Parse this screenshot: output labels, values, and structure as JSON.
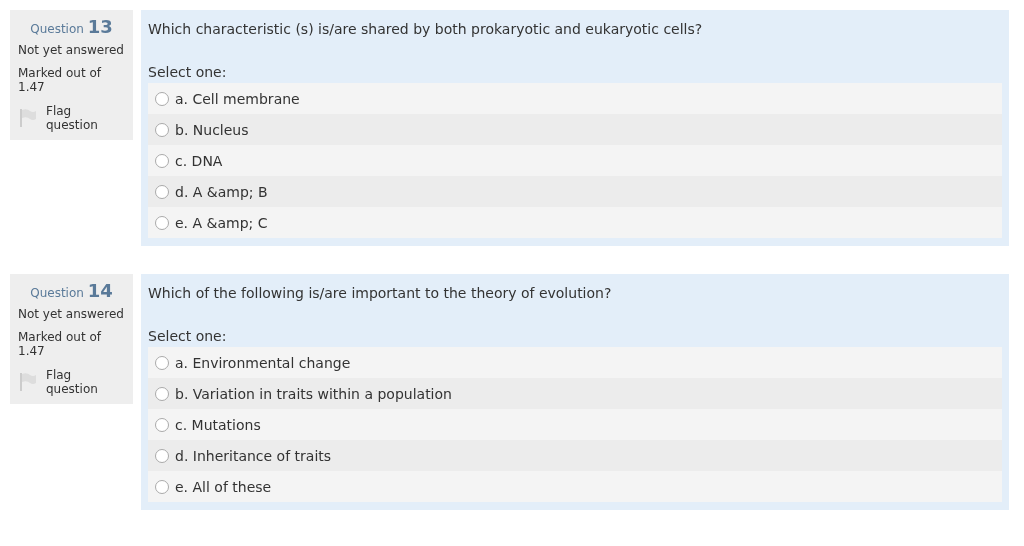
{
  "questions": [
    {
      "label": "Question",
      "number": "13",
      "status": "Not yet answered",
      "marked": "Marked out of",
      "mark": "1.47",
      "flag": "Flag question",
      "flagged": false,
      "text": "Which characteristic (s) is/are shared by both prokaryotic and eukaryotic cells?",
      "prompt": "Select one:",
      "options": [
        {
          "label": "a. Cell membrane",
          "selected": false
        },
        {
          "label": "b. Nucleus",
          "selected": false
        },
        {
          "label": "c. DNA",
          "selected": false
        },
        {
          "label": "d. A &amp; B",
          "selected": false
        },
        {
          "label": "e. A &amp; C",
          "selected": false
        }
      ]
    },
    {
      "label": "Question",
      "number": "14",
      "status": "Not yet answered",
      "marked": "Marked out of",
      "mark": "1.47",
      "flag": "Flag question",
      "flagged": false,
      "text": "Which of the following is/are important to the theory of evolution?",
      "prompt": "Select one:",
      "options": [
        {
          "label": "a. Environmental change",
          "selected": false
        },
        {
          "label": "b. Variation in traits within a population",
          "selected": false
        },
        {
          "label": "c. Mutations",
          "selected": false
        },
        {
          "label": "d. Inheritance of traits",
          "selected": false
        },
        {
          "label": "e. All of these",
          "selected": false
        }
      ]
    }
  ]
}
